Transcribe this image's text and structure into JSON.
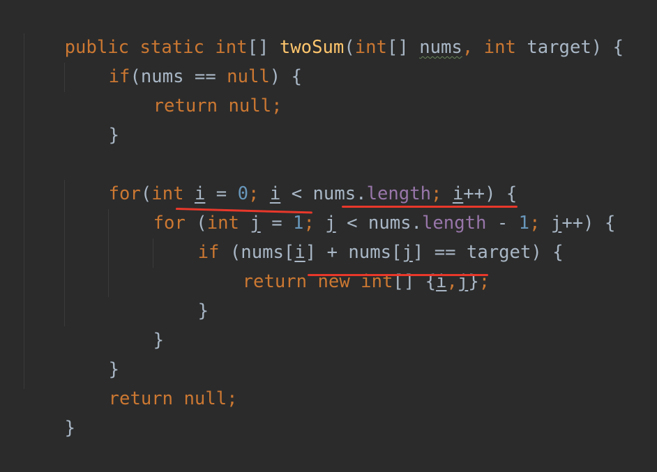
{
  "code": {
    "l1": {
      "t1": "public",
      "t2": " ",
      "t3": "static",
      "t4": " ",
      "t5": "int",
      "t6": "[] ",
      "t7": "twoSum",
      "t8": "(",
      "t9": "int",
      "t10": "[] ",
      "t11": "nums",
      "t12": ", ",
      "t13": "int",
      "t14": " target) {"
    },
    "l2": {
      "t1": "if",
      "t2": "(nums == ",
      "t3": "null",
      "t4": ") {"
    },
    "l3": {
      "t1": "return",
      "t2": " ",
      "t3": "null",
      "t4": ";"
    },
    "l4": {
      "t1": "}"
    },
    "l5": {
      "t1": "for",
      "t2": "(",
      "t3": "int",
      "t4": " ",
      "t5": "i",
      "t6": " = ",
      "t7": "0",
      "t8": "; ",
      "t9": "i",
      "t10": " < nums.",
      "t11": "length",
      "t12": "; ",
      "t13": "i",
      "t14": "++) {"
    },
    "l6": {
      "t1": "for",
      "t2": " (",
      "t3": "int",
      "t4": " ",
      "t5": "j",
      "t6": " = ",
      "t7": "1",
      "t8": "; ",
      "t9": "j",
      "t10": " < nums.",
      "t11": "length",
      "t12": " - ",
      "t13": "1",
      "t14": "; ",
      "t15": "j",
      "t16": "++) {"
    },
    "l7": {
      "t1": "if",
      "t2": " (nums[",
      "t3": "i",
      "t4": "] + nums[",
      "t5": "j",
      "t6": "] == target) {"
    },
    "l8": {
      "t1": "return",
      "t2": " ",
      "t3": "new",
      "t4": " ",
      "t5": "int",
      "t6": "[] {",
      "t7": "i",
      "t8": ",",
      "t9": "j",
      "t10": "}",
      "t11": ";"
    },
    "l9": {
      "t1": "}"
    },
    "l10": {
      "t1": "}"
    },
    "l11": {
      "t1": "}"
    },
    "l12": {
      "t1": "return",
      "t2": " ",
      "t3": "null",
      "t4": ";"
    },
    "l13": {
      "t1": "}"
    }
  },
  "colors": {
    "background": "#2b2b2b",
    "keyword": "#cc7832",
    "method": "#ffc66d",
    "number": "#6897bb",
    "field": "#9876aa",
    "text": "#a9b7c6",
    "annotation": "#e8382b"
  }
}
